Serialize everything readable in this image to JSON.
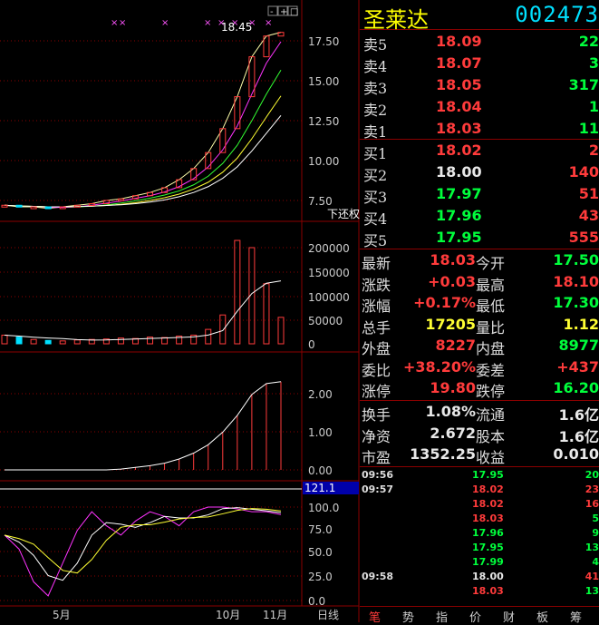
{
  "stock": {
    "name": "圣莱达",
    "code": "002473"
  },
  "colors": {
    "up": "#ff3b3b",
    "down": "#00ff3c",
    "neutral": "#e8e8e8",
    "cyan": "#00e0ff",
    "yellow": "#ffff33",
    "grid": "#8b0000"
  },
  "order_book": {
    "asks": [
      {
        "label": "卖5",
        "price": "18.09",
        "volume": "22"
      },
      {
        "label": "卖4",
        "price": "18.07",
        "volume": "3"
      },
      {
        "label": "卖3",
        "price": "18.05",
        "volume": "317"
      },
      {
        "label": "卖2",
        "price": "18.04",
        "volume": "1"
      },
      {
        "label": "卖1",
        "price": "18.03",
        "volume": "11"
      }
    ],
    "bids": [
      {
        "label": "买1",
        "price": "18.02",
        "volume": "2"
      },
      {
        "label": "买2",
        "price": "18.00",
        "volume": "140"
      },
      {
        "label": "买3",
        "price": "17.97",
        "volume": "51"
      },
      {
        "label": "买4",
        "price": "17.96",
        "volume": "43"
      },
      {
        "label": "买5",
        "price": "17.95",
        "volume": "555"
      }
    ]
  },
  "stats": [
    {
      "l1": "最新",
      "v1": "18.03",
      "l2": "今开",
      "v2": "17.50"
    },
    {
      "l1": "涨跌",
      "v1": "+0.03",
      "l2": "最高",
      "v2": "18.10"
    },
    {
      "l1": "涨幅",
      "v1": "+0.17%",
      "l2": "最低",
      "v2": "17.30"
    },
    {
      "l1": "总手",
      "v1": "17205",
      "l2": "量比",
      "v2": "1.12"
    },
    {
      "l1": "外盘",
      "v1": "8227",
      "l2": "内盘",
      "v2": "8977"
    },
    {
      "l1": "委比",
      "v1": "+38.20%",
      "l2": "委差",
      "v2": "+437"
    },
    {
      "l1": "涨停",
      "v1": "19.80",
      "l2": "跌停",
      "v2": "16.20"
    }
  ],
  "fund_stats": [
    {
      "l1": "换手",
      "v1": "1.08%",
      "l2": "流通",
      "v2": "1.6亿"
    },
    {
      "l1": "净资",
      "v1": "2.672",
      "l2": "股本",
      "v2": "1.6亿"
    },
    {
      "l1": "市盈",
      "v1": "1352.25",
      "l2": "收益",
      "v2": "0.010"
    }
  ],
  "ticks": [
    {
      "time": "09:56",
      "price": "17.95",
      "volume": "20"
    },
    {
      "time": "09:57",
      "price": "18.02",
      "volume": "23"
    },
    {
      "time": "",
      "price": "18.02",
      "volume": "16"
    },
    {
      "time": "",
      "price": "18.03",
      "volume": "5"
    },
    {
      "time": "",
      "price": "17.96",
      "volume": "9"
    },
    {
      "time": "",
      "price": "17.95",
      "volume": "13"
    },
    {
      "time": "",
      "price": "17.99",
      "volume": "4"
    },
    {
      "time": "09:58",
      "price": "18.00",
      "volume": "41"
    },
    {
      "time": "",
      "price": "18.03",
      "volume": "13"
    }
  ],
  "tabs": [
    "笔",
    "势",
    "指",
    "价",
    "财",
    "板",
    "筹"
  ],
  "chart": {
    "high_label": "18.45",
    "adjust_label": "下还权",
    "period_label": "日线",
    "x_labels": [
      "5月",
      "10月",
      "11月"
    ],
    "kline_axis": [
      "17.50",
      "15.00",
      "12.50",
      "10.00",
      "7.50"
    ],
    "volume_axis": [
      "200000",
      "150000",
      "100000",
      "50000",
      "0"
    ],
    "macd_axis": [
      "2.00",
      "1.00",
      "0.00"
    ],
    "kdj_axis": [
      "100.0",
      "75.0",
      "50.0",
      "25.0",
      "0.0"
    ],
    "kdj_current": "121.1",
    "toolbar": [
      "-",
      "+",
      "□"
    ]
  },
  "chart_data": {
    "type": "line",
    "series": [
      {
        "values": [
          7.2,
          7.1,
          7.1,
          7.0,
          7.1,
          7.2,
          7.3,
          7.5,
          7.6,
          7.8,
          8.0,
          8.3,
          8.8,
          9.5,
          10.5,
          12.0,
          14.0,
          16.5,
          17.8,
          18.03
        ]
      }
    ],
    "ylim": [
      6.5,
      18.5
    ]
  }
}
